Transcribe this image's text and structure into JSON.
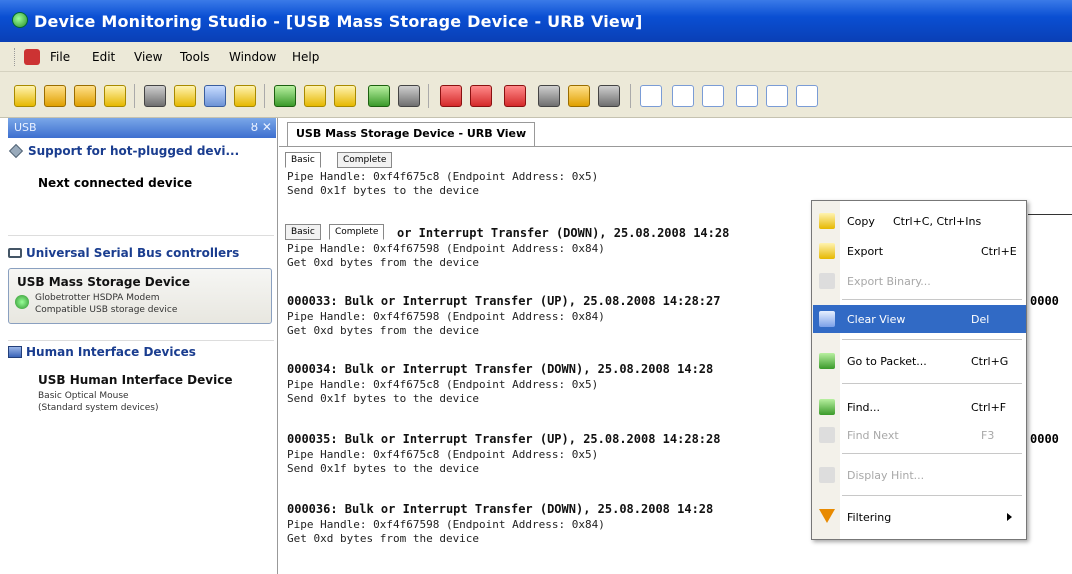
{
  "window": {
    "title": "Device Monitoring Studio - [USB Mass Storage Device - URB View]"
  },
  "menu": [
    "File",
    "Edit",
    "View",
    "Tools",
    "Window",
    "Help"
  ],
  "left_panel": {
    "header": "USB",
    "header_controls": "ȣ ✕",
    "hotplug": {
      "title": "Support for hot-plugged devi...",
      "item": "Next connected device"
    },
    "usb_section": {
      "title": "Universal Serial Bus controllers",
      "device": {
        "name": "USB Mass Storage Device",
        "line1": "Globetrotter HSDPA Modem",
        "line2": "Compatible USB storage device"
      }
    },
    "hid_section": {
      "title": "Human Interface Devices",
      "device": {
        "name": "USB Human Interface Device",
        "line1": "Basic Optical Mouse",
        "line2": "(Standard system devices)"
      }
    }
  },
  "document_tab": "USB Mass Storage Device - URB View",
  "view_tabs": [
    "Basic",
    "Complete"
  ],
  "packets": {
    "p0": {
      "pipe": "Pipe Handle: 0xf4f675c8 (Endpoint Address: 0x5)",
      "send": "Send 0x1f bytes to the device"
    },
    "p32": {
      "head_visible": "or Interrupt Transfer (DOWN), 25.08.2008 14:28",
      "pipe": "Pipe Handle: 0xf4f67598 (Endpoint Address: 0x84)",
      "get": "Get 0xd bytes from the device"
    },
    "p33": {
      "head": "000033: Bulk or Interrupt Transfer (UP), 25.08.2008 14:28:27",
      "pipe": "Pipe Handle: 0xf4f67598 (Endpoint Address: 0x84)",
      "get": "Get 0xd bytes from the device",
      "tail": "0000"
    },
    "p34": {
      "head": "000034: Bulk or Interrupt Transfer (DOWN), 25.08.2008 14:28",
      "pipe": "Pipe Handle: 0xf4f675c8 (Endpoint Address: 0x5)",
      "send": "Send 0x1f bytes to the device"
    },
    "p35": {
      "head": "000035: Bulk or Interrupt Transfer (UP), 25.08.2008 14:28:28",
      "pipe": "Pipe Handle: 0xf4f675c8 (Endpoint Address: 0x5)",
      "send": "Send 0x1f bytes to the device",
      "tail": "0000"
    },
    "p36": {
      "head": "000036: Bulk or Interrupt Transfer (DOWN), 25.08.2008 14:28",
      "pipe": "Pipe Handle: 0xf4f67598 (Endpoint Address: 0x84)",
      "get": "Get 0xd bytes from the device"
    }
  },
  "context_menu": {
    "copy": {
      "label": "Copy",
      "shortcut": "Ctrl+C, Ctrl+Ins"
    },
    "export": {
      "label": "Export",
      "shortcut": "Ctrl+E"
    },
    "export_binary": {
      "label": "Export Binary..."
    },
    "clear_view": {
      "label": "Clear View",
      "shortcut": "Del"
    },
    "go_to_packet": {
      "label": "Go to Packet...",
      "shortcut": "Ctrl+G"
    },
    "find": {
      "label": "Find...",
      "shortcut": "Ctrl+F"
    },
    "find_next": {
      "label": "Find Next",
      "shortcut": "F3"
    },
    "display_hint": {
      "label": "Display Hint..."
    },
    "filtering": {
      "label": "Filtering"
    }
  },
  "colors": {
    "title_blue": "#0a4fd3",
    "selection": "#316ac5",
    "chrome": "#ece9d8"
  }
}
